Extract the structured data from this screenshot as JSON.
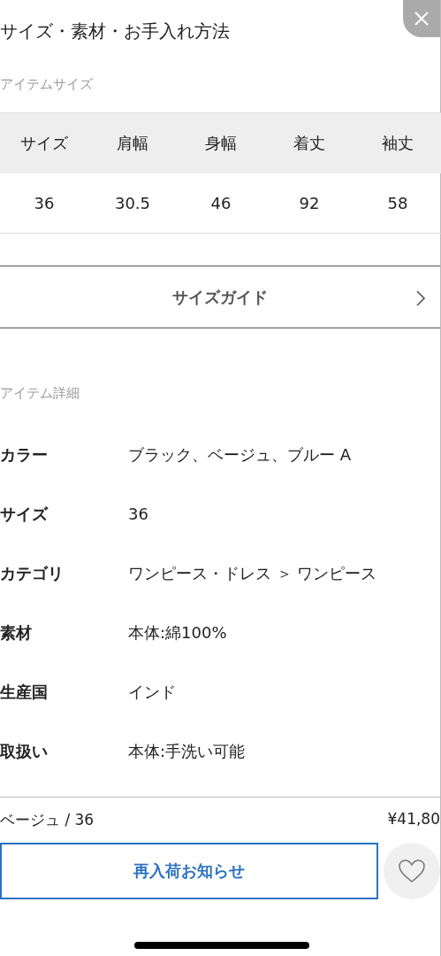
{
  "title": "サイズ・素材・お手入れ方法",
  "size_section": {
    "label": "アイテムサイズ",
    "columns": [
      "サイズ",
      "肩幅",
      "身幅",
      "着丈",
      "袖丈"
    ],
    "rows": [
      [
        "36",
        "30.5",
        "46",
        "92",
        "58"
      ]
    ]
  },
  "size_guide": {
    "label": "サイズガイド"
  },
  "detail_section": {
    "label": "アイテム詳細",
    "rows": [
      {
        "key": "カラー",
        "value": "ブラック、ベージュ、ブルー A"
      },
      {
        "key": "サイズ",
        "value": "36"
      },
      {
        "key": "カテゴリ",
        "value": "ワンピース・ドレス ＞ ワンピース"
      },
      {
        "key": "素材",
        "value": "本体:綿100%"
      },
      {
        "key": "生産国",
        "value": "インド"
      },
      {
        "key": "取扱い",
        "value": "本体:手洗い可能"
      }
    ]
  },
  "footer": {
    "variant": "ベージュ / 36",
    "price": "¥41,80",
    "button": "再入荷お知らせ"
  }
}
